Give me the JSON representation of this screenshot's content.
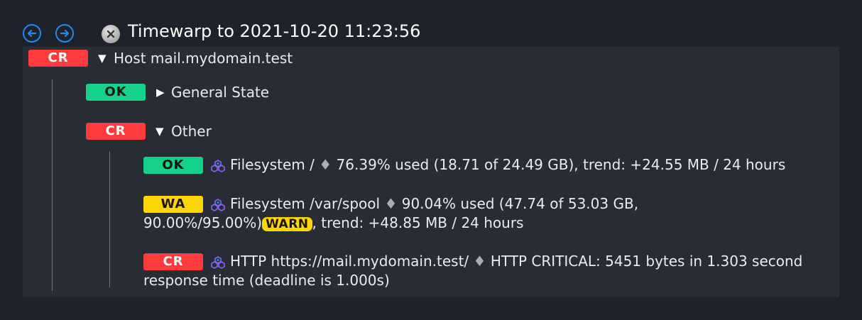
{
  "header": {
    "title": "Timewarp to 2021-10-20 11:23:56"
  },
  "tree": {
    "host": {
      "state": "CR",
      "label": "Host mail.mydomain.test"
    },
    "general": {
      "state": "OK",
      "label": "General State"
    },
    "other": {
      "state": "CR",
      "label": "Other"
    },
    "services": [
      {
        "state": "OK",
        "name": "Filesystem /",
        "separator": "♦",
        "text": "76.39% used (18.71 of 24.49 GB), trend: +24.55 MB / 24 hours"
      },
      {
        "state": "WA",
        "name": "Filesystem /var/spool",
        "separator": "♦",
        "text_line1": "90.04% used (47.74 of 53.03 GB,",
        "text_line2a": "90.00%/95.00%)",
        "inline_badge": "WARN",
        "text_line2b": ", trend: +48.85 MB / 24 hours"
      },
      {
        "state": "CR",
        "name": "HTTP https://mail.mydomain.test/",
        "separator": "♦",
        "text_line1": "HTTP CRITICAL: 5451 bytes in 1.303 second",
        "text_line2": "response time (deadline is 1.000s)"
      }
    ]
  },
  "colors": {
    "critical": "#ff3b3b",
    "ok": "#16d18a",
    "warning": "#ffd500",
    "accent": "#1e8bf0"
  }
}
